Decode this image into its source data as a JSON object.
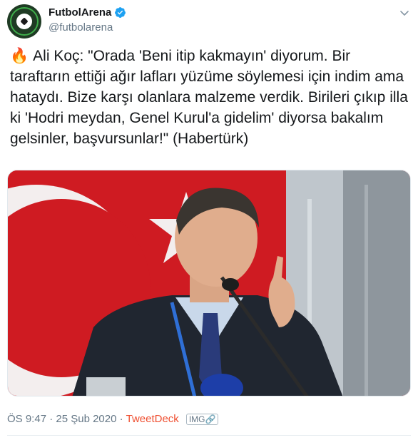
{
  "tweet": {
    "author_name": "FutbolArena",
    "author_handle": "@futbolarena",
    "emoji": "🔥",
    "text": "Ali Koç: \"Orada 'Beni itip kakmayın' diyorum. Bir taraftarın ettiği ağır lafları yüzüme söylemesi için indim ama hataydı. Bize karşı olanlara malzeme verdik. Birileri çıkıp illa ki 'Hodri meydan, Genel Kurul'a gidelim' diyorsa bakalım gelsinler, başvursunlar!\" (Habertürk)",
    "timestamp": "ÖS 9:47 · 25 Şub 2020 · ",
    "source": "TweetDeck",
    "image_badge": "IMG🔗"
  },
  "icons": {
    "verified": "verified-badge-icon",
    "caret": "chevron-down-icon",
    "avatar": "soccer-ball-logo"
  },
  "colors": {
    "link": "#1da1f2",
    "source": "#ef4f31",
    "muted": "#657786",
    "flag_red": "#cf1b22"
  }
}
